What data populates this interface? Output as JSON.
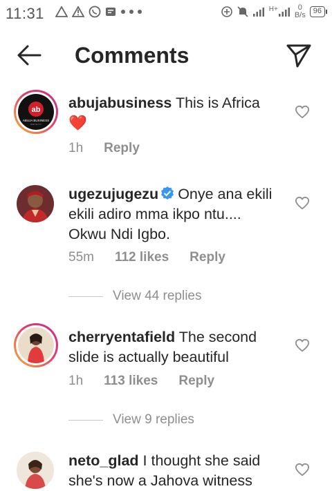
{
  "status_bar": {
    "time": "11:31",
    "network_type": "H+",
    "speed_value": "0",
    "speed_unit": "B/s",
    "battery": "96"
  },
  "header": {
    "title": "Comments"
  },
  "comments": [
    {
      "username": "abujabusiness",
      "text": "This is Africa",
      "emoji": "❤️",
      "time": "1h",
      "likes": "",
      "reply_label": "Reply",
      "view_replies": ""
    },
    {
      "username": "ugezujugezu",
      "verified": true,
      "text": "Onye ana ekili ekili adiro mma ikpo ntu.... Okwu Ndi Igbo.",
      "time": "55m",
      "likes": "112 likes",
      "reply_label": "Reply",
      "view_replies": "View 44 replies"
    },
    {
      "username": "cherryentafield",
      "text": "The second slide is actually beautiful",
      "time": "1h",
      "likes": "113 likes",
      "reply_label": "Reply",
      "view_replies": "View 9 replies"
    },
    {
      "username": "neto_glad",
      "text": "I thought she said she's now a Jahova witness"
    }
  ],
  "avatars": {
    "abujabusiness_logo": "ABUJA BUSINESS",
    "abujabusiness_sub": "N E T  E T Y"
  },
  "colors": {
    "text": "#262626",
    "secondary": "#8e8e8e",
    "verified": "#3897f0",
    "heart": "#ed4956"
  }
}
